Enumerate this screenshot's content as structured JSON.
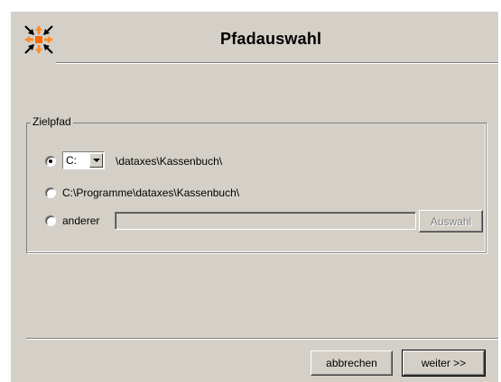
{
  "dialog": {
    "title": "Pfadauswahl"
  },
  "header": {
    "logo_icon": "dataxes-arrows-logo-icon",
    "logo_colors": [
      "#ff6a00",
      "#000000"
    ]
  },
  "target_group": {
    "legend": "Zielpfad",
    "options": [
      {
        "drive_value": "C:",
        "path_suffix": "\\dataxes\\Kassenbuch\\",
        "selected": true
      },
      {
        "label": "C:\\Programme\\dataxes\\Kassenbuch\\",
        "selected": false
      },
      {
        "label": "anderer",
        "field_value": "",
        "select_button": "Auswahl",
        "selected": false
      }
    ]
  },
  "footer": {
    "cancel_label": "abbrechen",
    "next_label": "weiter >>"
  }
}
